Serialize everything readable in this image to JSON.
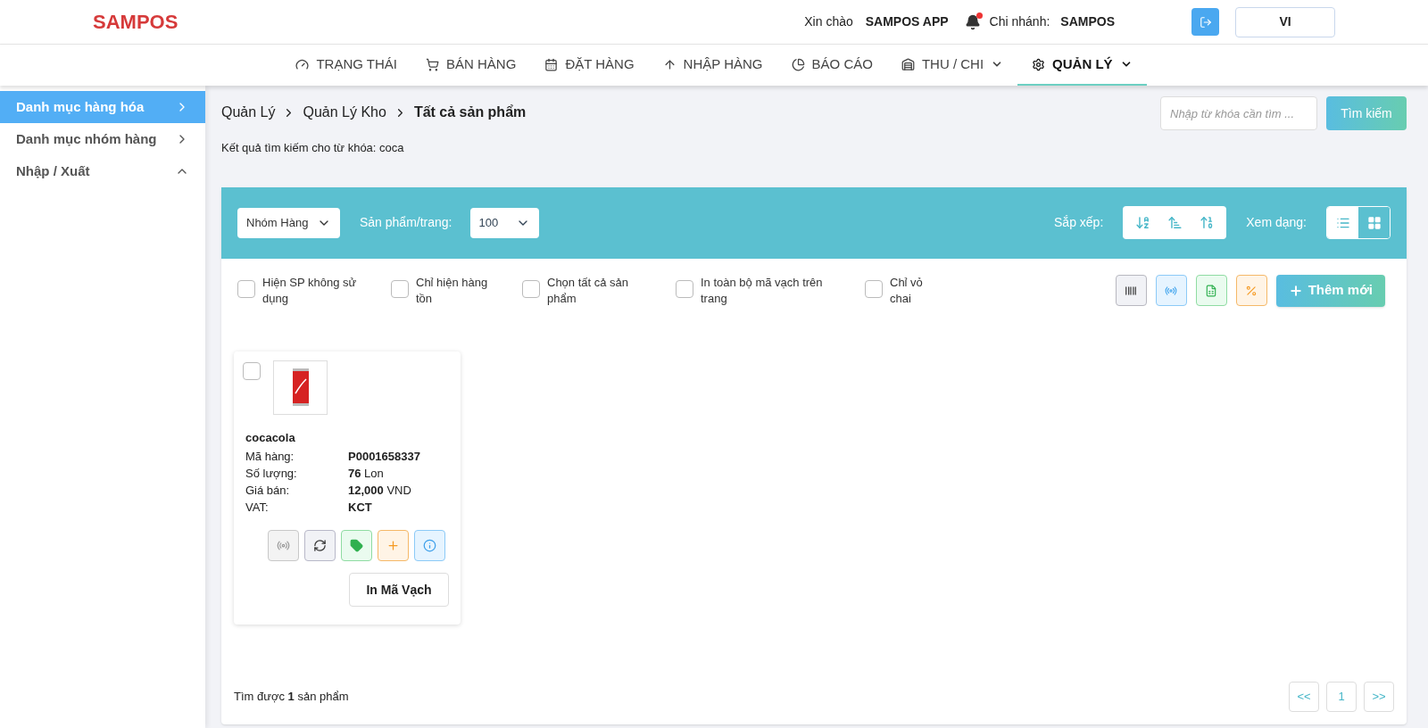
{
  "header": {
    "logo": "SAMPOS",
    "greeting": "Xin chào",
    "user": "SAMPOS APP",
    "has_notification": true,
    "branch_label": "Chi nhánh:",
    "branch": "SAMPOS",
    "language": "VI"
  },
  "nav": [
    {
      "label": "TRẠNG THÁI",
      "kind": "status",
      "selected": false,
      "has_menu": false
    },
    {
      "label": "BÁN HÀNG",
      "kind": "sales",
      "selected": false,
      "has_menu": false
    },
    {
      "label": "ĐẶT HÀNG",
      "kind": "order",
      "selected": false,
      "has_menu": false
    },
    {
      "label": "NHẬP HÀNG",
      "kind": "import",
      "selected": false,
      "has_menu": false
    },
    {
      "label": "BÁO CÁO",
      "kind": "report",
      "selected": false,
      "has_menu": false
    },
    {
      "label": "THU / CHI",
      "kind": "cash",
      "selected": false,
      "has_menu": true
    },
    {
      "label": "QUẢN LÝ",
      "kind": "manage",
      "selected": true,
      "has_menu": true
    }
  ],
  "sidebar": {
    "items": [
      {
        "label": "Danh mục hàng hóa",
        "selected": true,
        "expanded": false
      },
      {
        "label": "Danh mục nhóm hàng",
        "selected": false,
        "expanded": false
      },
      {
        "label": "Nhập / Xuất",
        "selected": false,
        "expanded": true
      }
    ]
  },
  "breadcrumb": [
    "Quản Lý",
    "Quản Lý Kho",
    "Tất cả sản phẩm"
  ],
  "search": {
    "placeholder": "Nhập từ khóa cần tìm ...",
    "button": "Tìm kiếm"
  },
  "result_text": "Kết quả tìm kiếm cho từ khóa: coca",
  "toolbar": {
    "group_select": "Nhóm Hàng",
    "per_page_label": "Sản phẩm/trang:",
    "per_page": "100",
    "sort_label": "Sắp xếp:",
    "sort_buttons": [
      {
        "kind": "az"
      },
      {
        "kind": "wide"
      },
      {
        "kind": "num"
      }
    ],
    "view_label": "Xem dạng:",
    "view_modes": [
      {
        "kind": "list",
        "selected": false
      },
      {
        "kind": "grid",
        "selected": true
      }
    ]
  },
  "filters": [
    {
      "label": "Hiện SP không sử dụng",
      "checked": false
    },
    {
      "label": "Chỉ hiện hàng tồn",
      "checked": false
    },
    {
      "label": "Chọn tất cả sản phẩm",
      "checked": false
    },
    {
      "label": "In toàn bộ mã vạch trên trang",
      "checked": false
    },
    {
      "label": "Chỉ vỏ chai",
      "checked": false
    }
  ],
  "actions": [
    {
      "kind": "barcode"
    },
    {
      "kind": "signal"
    },
    {
      "kind": "excel"
    },
    {
      "kind": "percent"
    }
  ],
  "add_button": "Thêm mới",
  "products": [
    {
      "name": "cocacola",
      "checked": false,
      "fields": [
        {
          "label": "Mã hàng:",
          "value": "**P0001658337**"
        },
        {
          "label": "Số lượng:",
          "value": "**76** Lon"
        },
        {
          "label": "Giá bán:",
          "value": "**12,000** VND"
        },
        {
          "label": "VAT:",
          "value": "**KCT**"
        }
      ],
      "buttons": [
        {
          "kind": "signal"
        },
        {
          "kind": "sync"
        },
        {
          "kind": "tag"
        },
        {
          "kind": "add"
        },
        {
          "kind": "info"
        }
      ],
      "print_button": "In Mã Vạch"
    }
  ],
  "footer": {
    "count_text": "Tìm được **1** sản phẩm",
    "pagination": {
      "prev": "<<",
      "pages": [
        "1"
      ],
      "next": ">>"
    }
  }
}
